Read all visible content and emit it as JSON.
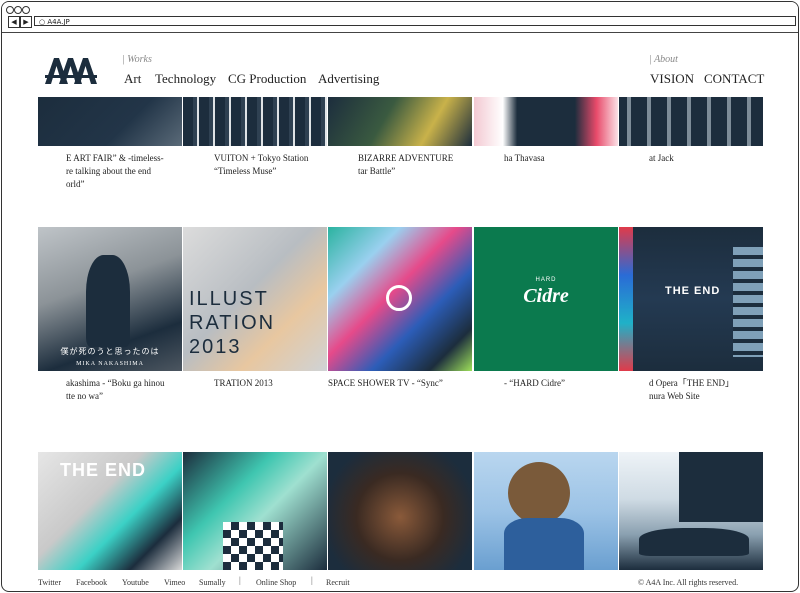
{
  "browser": {
    "url": "A4A.JP",
    "back_label": "◀",
    "forward_label": "▶"
  },
  "logo": {
    "text": "AAA"
  },
  "menu": {
    "works_label": "Works",
    "works_items": [
      "Art",
      "Technology",
      "CG Production",
      "Advertising"
    ],
    "about_label": "About",
    "about_items": [
      "VISION",
      "CONTACT"
    ]
  },
  "grid": {
    "row1_captions": [
      [
        "E ART FAIR” & -timeless-",
        "re talking about the end",
        "orld”"
      ],
      [
        "VUITON + Tokyo Station",
        "“Timeless Muse”"
      ],
      [
        "BIZARRE ADVENTURE",
        "tar Battle”"
      ],
      [
        "ha Thavasa"
      ],
      [
        "at Jack"
      ]
    ],
    "row2_captions": [
      [
        "akashima - “Boku ga hinou",
        "tte no wa”"
      ],
      [
        "TRATION 2013"
      ],
      [
        "SPACE SHOWER TV - “Sync”"
      ],
      [
        "- “HARD Cidre”"
      ],
      [
        "d Opera「THE END」",
        "nura Web Site"
      ]
    ],
    "overlays": {
      "mika_line1": "僕が死のうと思ったのは",
      "mika_line2": "MIKA NAKASHIMA",
      "illust_line1": "ILLUST",
      "illust_line2": "RATION",
      "illust_line3": "2013",
      "cidre_small": "HARD",
      "cidre_big": "Cidre",
      "theend": "THE END",
      "theend2": "THE END"
    }
  },
  "footer": {
    "links": [
      "Twitter",
      "Facebook",
      "Youtube",
      "Vimeo",
      "Sumally",
      "Online Shop",
      "Recruit"
    ],
    "separators": [
      "|",
      "|"
    ],
    "copyright": "© A4A Inc. All rights reserved."
  },
  "colors": {
    "navy": "#1c2d3d",
    "green": "#0b7a4e",
    "text": "#222222"
  }
}
